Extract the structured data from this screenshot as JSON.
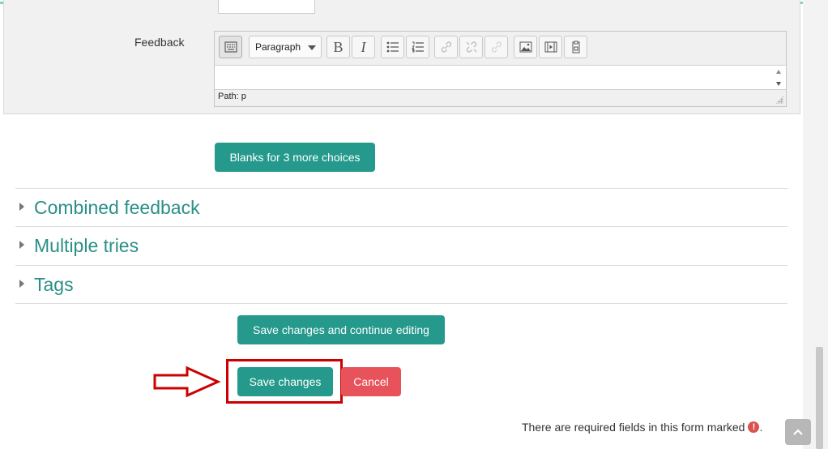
{
  "editor": {
    "label": "Feedback",
    "format_select": "Paragraph",
    "path": "Path: p",
    "toolbar_icons": [
      "toolbar-toggle-icon",
      "bold-icon",
      "italic-icon",
      "unordered-list-icon",
      "ordered-list-icon",
      "link-icon",
      "unlink-icon",
      "anchor-icon",
      "image-icon",
      "media-icon",
      "paste-icon"
    ]
  },
  "buttons": {
    "blanks": "Blanks for 3 more choices",
    "save_continue": "Save changes and continue editing",
    "save": "Save changes",
    "cancel": "Cancel"
  },
  "sections": [
    {
      "title": "Combined feedback"
    },
    {
      "title": "Multiple tries"
    },
    {
      "title": "Tags"
    }
  ],
  "footer": {
    "required_note": "There are required fields in this form marked",
    "required_icon": "!",
    "required_end": "."
  },
  "colors": {
    "accent": "#24998c",
    "danger": "#e8525a",
    "highlight": "#cc0000",
    "section_title": "#2a8f86"
  }
}
